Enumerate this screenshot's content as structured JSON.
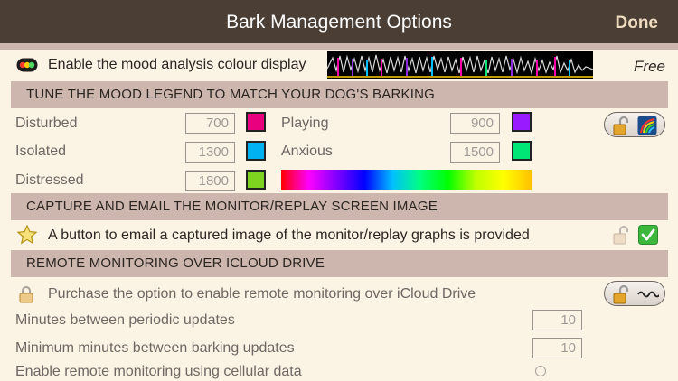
{
  "nav": {
    "title": "Bark Management Options",
    "done_label": "Done"
  },
  "mood_display": {
    "label": "Enable the mood analysis colour display",
    "price": "Free",
    "icon": "traffic-light-icon"
  },
  "legend_section": {
    "header": "TUNE THE MOOD LEGEND TO MATCH YOUR DOG'S BARKING",
    "moods": [
      {
        "label": "Disturbed",
        "value": "700",
        "color": "#e8007f"
      },
      {
        "label": "Playing",
        "value": "900",
        "color": "#9a1aff"
      },
      {
        "label": "Isolated",
        "value": "1300",
        "color": "#00b2f2"
      },
      {
        "label": "Anxious",
        "value": "1500",
        "color": "#00e676"
      },
      {
        "label": "Distressed",
        "value": "1800",
        "color": "#7ed321"
      }
    ]
  },
  "capture_section": {
    "header": "CAPTURE AND EMAIL THE MONITOR/REPLAY SCREEN IMAGE",
    "label": "A button to email a captured image of the monitor/replay graphs is provided"
  },
  "remote_section": {
    "header": "REMOTE MONITORING OVER ICLOUD DRIVE",
    "purchase_label": "Purchase the option to enable remote monitoring over iCloud Drive",
    "periodic_label": "Minutes between periodic updates",
    "periodic_value": "10",
    "barking_label": "Minimum minutes between barking updates",
    "barking_value": "10",
    "cellular_label": "Enable remote monitoring using cellular data"
  }
}
